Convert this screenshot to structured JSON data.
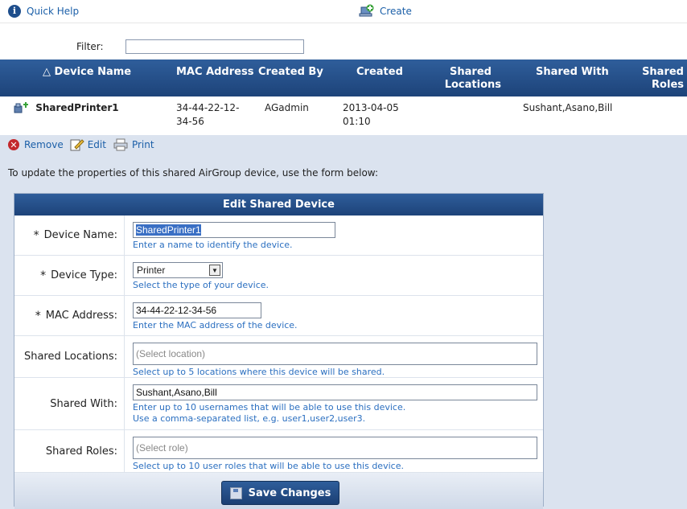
{
  "toolbar": {
    "quick_help": "Quick Help",
    "create": "Create"
  },
  "filter": {
    "label": "Filter:",
    "value": ""
  },
  "table": {
    "columns": [
      "△ Device Name",
      "MAC Address",
      "Created By",
      "Created",
      "Shared\nLocations",
      "Shared With",
      "Shared\nRoles"
    ],
    "col_device": "△ Device Name",
    "col_mac": "MAC Address",
    "col_created_by": "Created By",
    "col_created": "Created",
    "col_locations_1": "Shared",
    "col_locations_2": "Locations",
    "col_shared_with": "Shared With",
    "col_roles_1": "Shared",
    "col_roles_2": "Roles",
    "rows": [
      {
        "device_name": "SharedPrinter1",
        "mac_1": "34-44-22-12-",
        "mac_2": "34-56",
        "created_by": "AGadmin",
        "created_1": "2013-04-05",
        "created_2": "01:10",
        "shared_locations": "",
        "shared_with": "Sushant,Asano,Bill",
        "shared_roles": ""
      }
    ]
  },
  "actions": {
    "remove": "Remove",
    "edit": "Edit",
    "print": "Print"
  },
  "intro_text": "To update the properties of this shared AirGroup device, use the form below:",
  "form": {
    "title": "Edit Shared Device",
    "device_name": {
      "label": "Device Name:",
      "value": "SharedPrinter1",
      "hint": "Enter a name to identify the device."
    },
    "device_type": {
      "label": "Device Type:",
      "value": "Printer",
      "hint": "Select the type of your device."
    },
    "mac_address": {
      "label": "MAC Address:",
      "value": "34-44-22-12-34-56",
      "hint": "Enter the MAC address of the device."
    },
    "shared_locations": {
      "label": "Shared Locations:",
      "placeholder": "(Select location)",
      "hint": "Select up to 5 locations where this device will be shared."
    },
    "shared_with": {
      "label": "Shared With:",
      "value": "Sushant,Asano,Bill",
      "hint_1": "Enter up to 10 usernames that will be able to use this device.",
      "hint_2": "Use a comma-separated list, e.g. user1,user2,user3."
    },
    "shared_roles": {
      "label": "Shared Roles:",
      "placeholder": "(Select role)",
      "hint": "Select up to 10 user roles that will be able to use this device."
    },
    "save_label": "Save Changes",
    "required_marker": "*"
  }
}
